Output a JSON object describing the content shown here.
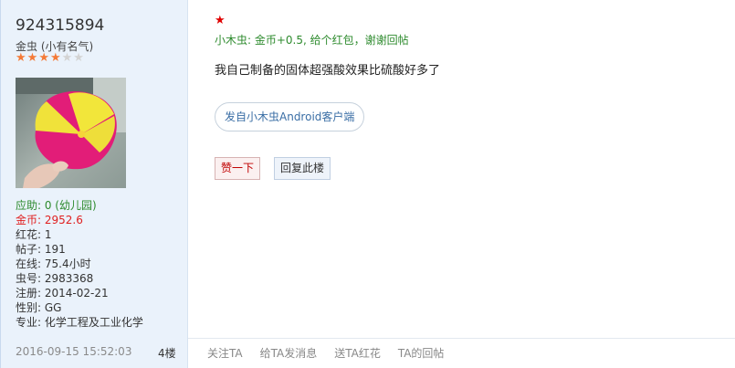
{
  "user": {
    "username": "924315894",
    "title": "金虫 (小有名气)",
    "rating": 4,
    "rating_max": 6,
    "stats": [
      {
        "text": "应助: 0 (幼儿园)",
        "style": "green"
      },
      {
        "text": "金币: 2952.6",
        "style": "red"
      },
      {
        "text": "红花: 1",
        "style": "normal"
      },
      {
        "text": "帖子: 191",
        "style": "normal"
      },
      {
        "text": "在线: 75.4小时",
        "style": "normal"
      },
      {
        "text": "虫号: 2983368",
        "style": "normal"
      },
      {
        "text": "注册: 2014-02-21",
        "style": "normal"
      },
      {
        "text": "性别: GG",
        "style": "normal"
      },
      {
        "text": "专业: 化学工程及工业化学",
        "style": "normal"
      }
    ]
  },
  "post": {
    "time": "2016-09-15 15:52:03",
    "floor": "4楼",
    "red_star": "★",
    "reward": "小木虫: 金币+0.5, 给个红包，谢谢回帖",
    "content": "我自己制备的固体超强酸效果比硫酸好多了",
    "client_tag": "发自小木虫Android客户端",
    "like_label": "赞一下",
    "reply_label": "回复此楼"
  },
  "footer_actions": [
    "关注TA",
    "给TA发消息",
    "送TA红花",
    "TA的回帖"
  ],
  "colors": {
    "sidebar_bg": "#eaf2fb",
    "star_on": "#f47a37",
    "green": "#2e8b2e",
    "red": "#e02020",
    "link_blue": "#3a6ea5"
  }
}
